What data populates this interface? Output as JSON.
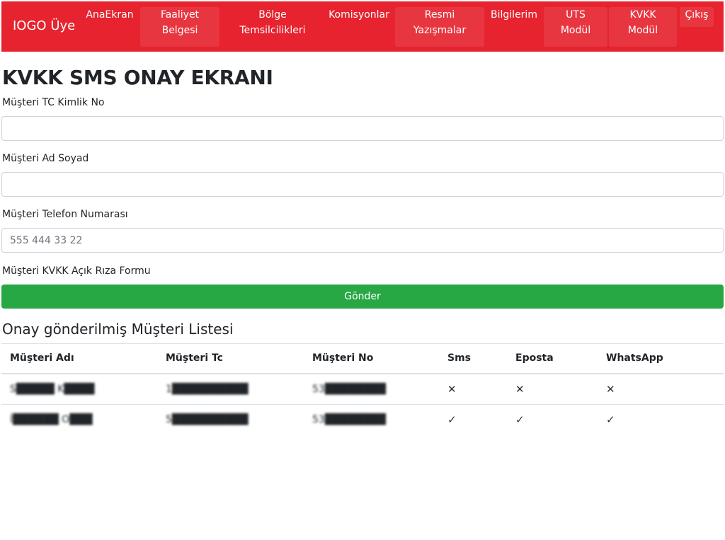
{
  "navbar": {
    "brand": "IOGO Üye",
    "items": [
      {
        "lines": [
          "AnaEkran"
        ]
      },
      {
        "lines": [
          "Faaliyet",
          "Belgesi"
        ]
      },
      {
        "lines": [
          "Bölge",
          "Temsilcilikleri"
        ]
      },
      {
        "lines": [
          "Komisyonlar"
        ]
      },
      {
        "lines": [
          "Resmi",
          "Yazışmalar"
        ]
      },
      {
        "lines": [
          "Bilgilerim"
        ]
      },
      {
        "lines": [
          "UTS",
          "Modül"
        ]
      },
      {
        "lines": [
          "KVKK",
          "Modül"
        ]
      },
      {
        "lines": [
          "Çıkış"
        ]
      }
    ]
  },
  "page": {
    "title": "KVKK SMS ONAY EKRANI"
  },
  "form": {
    "tc_label": "Müşteri TC Kimlik No",
    "tc_value": "",
    "name_label": "Müşteri Ad Soyad",
    "name_value": "",
    "phone_label": "Müşteri Telefon Numarası",
    "phone_placeholder": "555 444 33 22",
    "consent_label": "Müşteri KVKK Açık Rıza Formu",
    "submit_label": "Gönder"
  },
  "list": {
    "title": "Onay gönderilmiş Müşteri Listesi",
    "columns": [
      "Müşteri Adı",
      "Müşteri Tc",
      "Müşteri No",
      "Sms",
      "Eposta",
      "WhatsApp"
    ],
    "rows": [
      {
        "name": "S█████ K████",
        "tc": "1██████████",
        "no": "53████████",
        "sms": "✕",
        "email": "✕",
        "whatsapp": "✕"
      },
      {
        "name": "İ██████ O███",
        "tc": "5██████████",
        "no": "53████████",
        "sms": "✓",
        "email": "✓",
        "whatsapp": "✓"
      }
    ]
  },
  "colors": {
    "navbar": "#e6232f",
    "submit": "#28a745",
    "border": "#dee2e6"
  }
}
